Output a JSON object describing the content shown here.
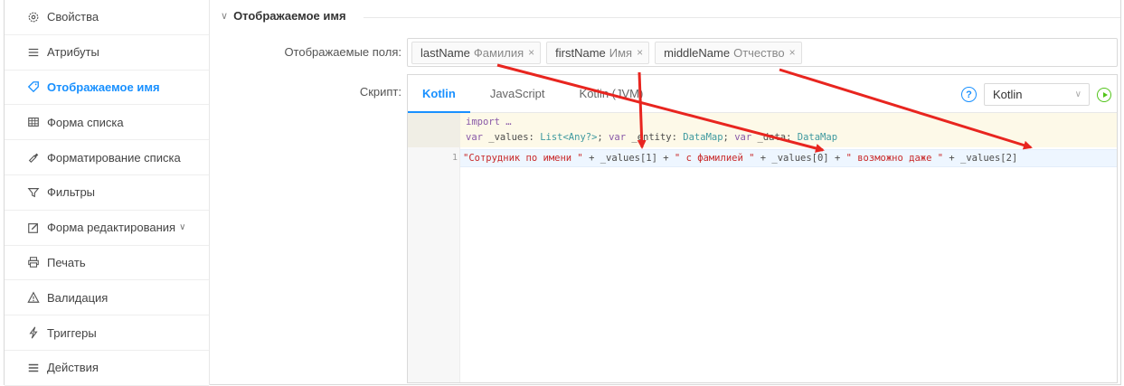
{
  "sidebar": {
    "items": [
      {
        "label": "Свойства",
        "icon": "gear-icon"
      },
      {
        "label": "Атрибуты",
        "icon": "list-icon"
      },
      {
        "label": "Отображаемое имя",
        "icon": "tag-icon"
      },
      {
        "label": "Форма списка",
        "icon": "table-icon"
      },
      {
        "label": "Форматирование списка",
        "icon": "format-painter-icon"
      },
      {
        "label": "Фильтры",
        "icon": "filter-icon"
      },
      {
        "label": "Форма редактирования",
        "icon": "edit-form-icon"
      },
      {
        "label": "Печать",
        "icon": "printer-icon"
      },
      {
        "label": "Валидация",
        "icon": "warning-icon"
      },
      {
        "label": "Триггеры",
        "icon": "lightning-icon"
      },
      {
        "label": "Действия",
        "icon": "menu-icon"
      }
    ],
    "active_index": 2
  },
  "main": {
    "section_title": "Отображаемое имя",
    "fields_label": "Отображаемые поля:",
    "script_label": "Скрипт:",
    "tags": [
      {
        "name": "lastName",
        "caption": "Фамилия",
        "remove": "×"
      },
      {
        "name": "firstName",
        "caption": "Имя",
        "remove": "×"
      },
      {
        "name": "middleName",
        "caption": "Отчество",
        "remove": "×"
      }
    ]
  },
  "script": {
    "tabs": [
      {
        "label": "Kotlin"
      },
      {
        "label": "JavaScript"
      },
      {
        "label": "Kotlin (JVM)"
      }
    ],
    "active_tab": 0,
    "help": "?",
    "language_select": "Kotlin",
    "header_line1": "import …",
    "header_line2_parts": [
      {
        "t": "var",
        "c": "kw"
      },
      {
        "t": " _values",
        "c": "id"
      },
      {
        "t": ": ",
        "c": "id"
      },
      {
        "t": "List<Any?>",
        "c": "tp"
      },
      {
        "t": "; ",
        "c": "id"
      },
      {
        "t": "var",
        "c": "kw"
      },
      {
        "t": " _entity",
        "c": "id"
      },
      {
        "t": ": ",
        "c": "id"
      },
      {
        "t": "DataMap",
        "c": "tp"
      },
      {
        "t": "; ",
        "c": "id"
      },
      {
        "t": "var",
        "c": "kw"
      },
      {
        "t": " _data",
        "c": "id"
      },
      {
        "t": ": ",
        "c": "id"
      },
      {
        "t": "DataMap",
        "c": "tp"
      }
    ],
    "line_number": "1",
    "code_parts": [
      {
        "t": "\"Сотрудник по имени \"",
        "c": "str"
      },
      {
        "t": " + _values[1] + ",
        "c": "id"
      },
      {
        "t": "\" с фамилией \"",
        "c": "str"
      },
      {
        "t": " + _values[0] + ",
        "c": "id"
      },
      {
        "t": "\" возможно даже \"",
        "c": "str"
      },
      {
        "t": " + _values[2]",
        "c": "id"
      }
    ]
  },
  "colors": {
    "accent": "#1890ff",
    "annotation_arrow": "#e8251f",
    "run": "#52c41a"
  }
}
